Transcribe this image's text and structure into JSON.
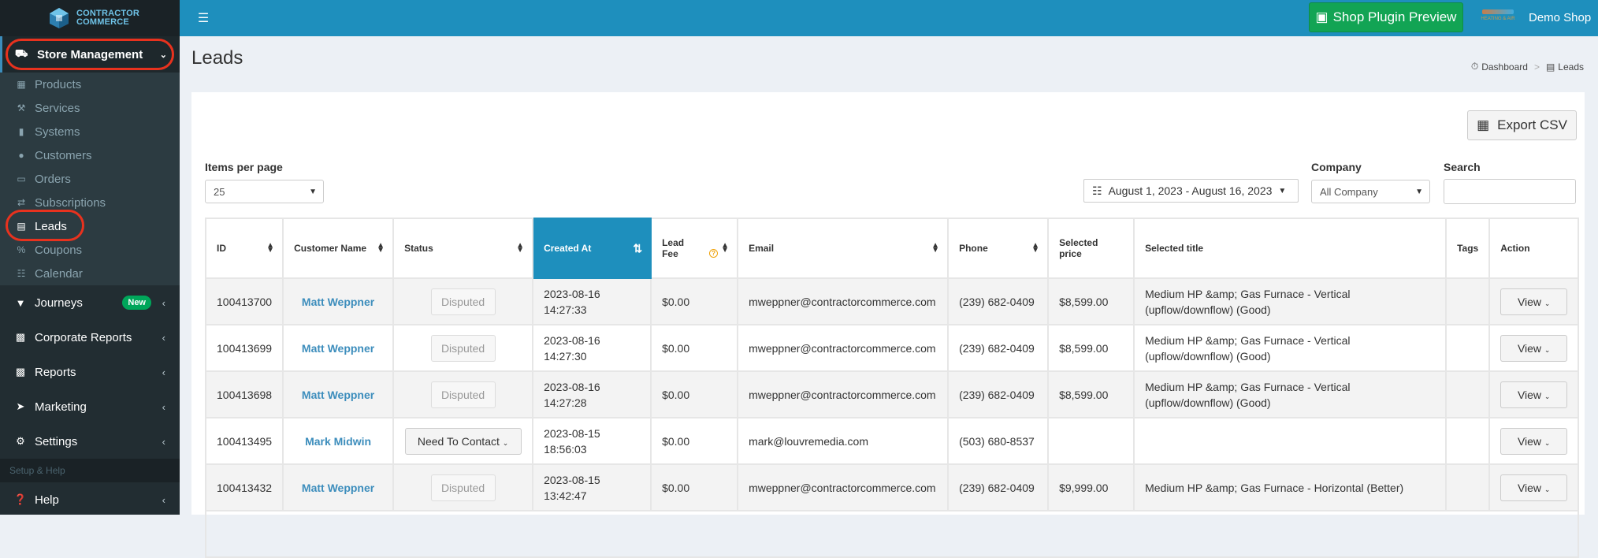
{
  "logo": {
    "line1": "CONTRACTOR",
    "line2": "COMMERCE"
  },
  "sidebar": {
    "store_management": "Store Management",
    "sub_items": [
      {
        "label": "Products",
        "icon": "cubes-icon"
      },
      {
        "label": "Services",
        "icon": "wrench-icon"
      },
      {
        "label": "Systems",
        "icon": "systems-icon"
      },
      {
        "label": "Customers",
        "icon": "users-icon"
      },
      {
        "label": "Orders",
        "icon": "inbox-icon"
      },
      {
        "label": "Subscriptions",
        "icon": "repeat-icon"
      },
      {
        "label": "Leads",
        "icon": "table-icon"
      },
      {
        "label": "Coupons",
        "icon": "percent-icon"
      },
      {
        "label": "Calendar",
        "icon": "calendar-icon"
      }
    ],
    "journeys": "Journeys",
    "journeys_badge": "New",
    "corporate_reports": "Corporate Reports",
    "reports": "Reports",
    "marketing": "Marketing",
    "settings": "Settings",
    "setup_header": "Setup & Help",
    "help": "Help"
  },
  "topbar": {
    "preview_label": "Shop Plugin Preview",
    "shop_name": "Demo Shop",
    "mini_brand": "HEATING & AIR"
  },
  "page": {
    "title": "Leads"
  },
  "breadcrumb": {
    "dashboard": "Dashboard",
    "current": "Leads"
  },
  "toolbar": {
    "export_label": "Export CSV",
    "items_per_page_label": "Items per page",
    "items_per_page_value": "25",
    "date_range": "August 1, 2023 - August 16, 2023",
    "company_label": "Company",
    "company_value": "All Company",
    "search_label": "Search"
  },
  "table": {
    "headers": {
      "id": "ID",
      "customer": "Customer Name",
      "status": "Status",
      "created": "Created At",
      "fee_1": "Lead",
      "fee_2": "Fee",
      "email": "Email",
      "phone": "Phone",
      "price": "Selected price",
      "title": "Selected title",
      "tags": "Tags",
      "action": "Action"
    },
    "rows": [
      {
        "id": "100413700",
        "name": "Matt Weppner",
        "status": "Disputed",
        "date": "2023-08-16",
        "time": "14:27:33",
        "fee": "$0.00",
        "email": "mweppner@contractorcommerce.com",
        "phone": "(239) 682-0409",
        "price": "$8,599.00",
        "title": "Medium HP &amp; Gas Furnace - Vertical (upflow/downflow) (Good)",
        "action": "View"
      },
      {
        "id": "100413699",
        "name": "Matt Weppner",
        "status": "Disputed",
        "date": "2023-08-16",
        "time": "14:27:30",
        "fee": "$0.00",
        "email": "mweppner@contractorcommerce.com",
        "phone": "(239) 682-0409",
        "price": "$8,599.00",
        "title": "Medium HP &amp; Gas Furnace - Vertical (upflow/downflow) (Good)",
        "action": "View"
      },
      {
        "id": "100413698",
        "name": "Matt Weppner",
        "status": "Disputed",
        "date": "2023-08-16",
        "time": "14:27:28",
        "fee": "$0.00",
        "email": "mweppner@contractorcommerce.com",
        "phone": "(239) 682-0409",
        "price": "$8,599.00",
        "title": "Medium HP &amp; Gas Furnace - Vertical (upflow/downflow) (Good)",
        "action": "View"
      },
      {
        "id": "100413495",
        "name": "Mark Midwin",
        "status": "Need To Contact",
        "date": "2023-08-15",
        "time": "18:56:03",
        "fee": "$0.00",
        "email": "mark@louvremedia.com",
        "phone": "(503) 680-8537",
        "price": "",
        "title": "",
        "action": "View"
      },
      {
        "id": "100413432",
        "name": "Matt Weppner",
        "status": "Disputed",
        "date": "2023-08-15",
        "time": "13:42:47",
        "fee": "$0.00",
        "email": "mweppner@contractorcommerce.com",
        "phone": "(239) 682-0409",
        "price": "$9,999.00",
        "title": "Medium HP &amp; Gas Furnace - Horizontal (Better)",
        "action": "View"
      }
    ]
  },
  "colors": {
    "sidebar": "#222d32",
    "topbar": "#1e8fbd",
    "preview_button": "#12a454",
    "highlight_ring": "#e8321e",
    "link": "#3c8dbc"
  }
}
